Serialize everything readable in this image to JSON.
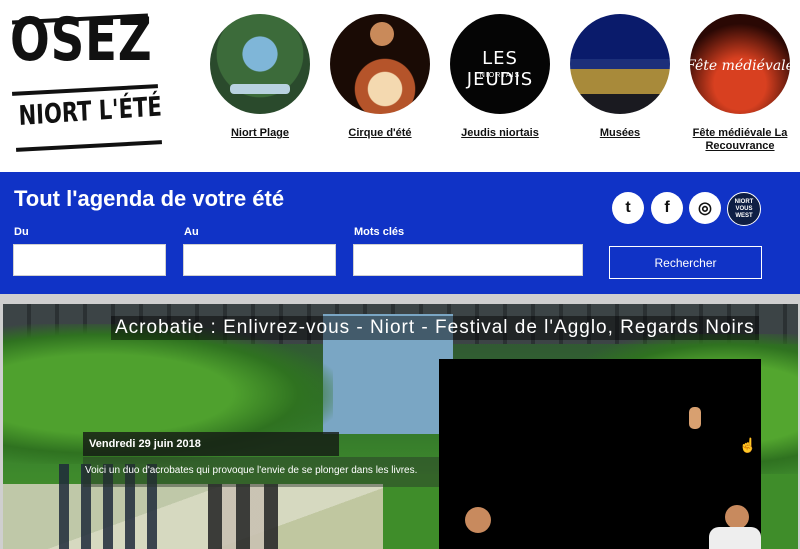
{
  "logo": {
    "line1": "OSEZ",
    "line2": "NIORT L'ÉTÉ"
  },
  "nav": [
    {
      "label": "Niort Plage"
    },
    {
      "label": "Cirque d'été"
    },
    {
      "label": "Jeudis niortais",
      "circle_text": "LES JEUDIS",
      "circle_sub": "NIORTAIS"
    },
    {
      "label": "Musées"
    },
    {
      "label": "Fête médiévale La Recouvrance",
      "circle_text": "Fête médiévale"
    }
  ],
  "agenda": {
    "title": "Tout l'agenda de votre été",
    "from_label": "Du",
    "to_label": "Au",
    "keywords_label": "Mots clés",
    "from_value": "",
    "to_value": "",
    "keywords_value": "",
    "search_label": "Rechercher"
  },
  "social": {
    "twitter": "t",
    "facebook": "f",
    "instagram": "◎",
    "niort_line1": "NIORT",
    "niort_line2": "VOUS WEST"
  },
  "hero": {
    "title": "Acrobatie : Enlivrez-vous - Niort - Festival de l'Agglo, Regards Noirs",
    "date": "Vendredi 29 juin 2018",
    "description": "Voici un duo d'acrobates qui provoque l'envie de se plonger dans les livres."
  },
  "colors": {
    "band": "#1033c6",
    "text_dark": "#111111"
  }
}
